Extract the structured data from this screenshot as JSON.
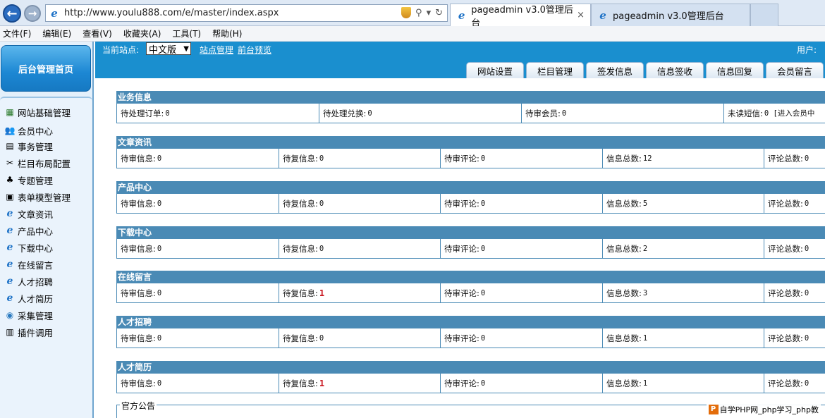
{
  "browser": {
    "address": "http://www.youlu888.com/e/master/index.aspx",
    "tabs": [
      {
        "label": "pageadmin v3.0管理后台",
        "close": "×"
      },
      {
        "label": "pageadmin v3.0管理后台"
      }
    ]
  },
  "menu": [
    "文件(F)",
    "编辑(E)",
    "查看(V)",
    "收藏夹(A)",
    "工具(T)",
    "帮助(H)"
  ],
  "sidebar": {
    "home": "后台管理首页",
    "items": [
      {
        "label": "网站基础管理",
        "icon": "site-basic-icon"
      },
      {
        "label": "会员中心",
        "icon": "members-icon"
      },
      {
        "label": "事务管理",
        "icon": "affairs-icon"
      },
      {
        "label": "栏目布局配置",
        "icon": "tools-icon"
      },
      {
        "label": "专题管理",
        "icon": "topic-icon"
      },
      {
        "label": "表单模型管理",
        "icon": "form-model-icon"
      },
      {
        "label": "文章资讯",
        "icon": "ie-icon"
      },
      {
        "label": "产品中心",
        "icon": "ie-icon"
      },
      {
        "label": "下载中心",
        "icon": "ie-icon"
      },
      {
        "label": "在线留言",
        "icon": "ie-icon"
      },
      {
        "label": "人才招聘",
        "icon": "ie-icon"
      },
      {
        "label": "人才简历",
        "icon": "ie-icon"
      },
      {
        "label": "采集管理",
        "icon": "globe-icon"
      },
      {
        "label": "插件调用",
        "icon": "plugin-icon"
      }
    ]
  },
  "header": {
    "site_label": "当前站点:",
    "site_value": "中文版",
    "link_site": "站点管理",
    "link_preview": "前台预览",
    "user_label": "用户:",
    "tabs": [
      "网站设置",
      "栏目管理",
      "签发信息",
      "信息签收",
      "信息回复",
      "会员留言"
    ]
  },
  "sections": [
    {
      "title": "业务信息",
      "cells": [
        {
          "label": "待处理订单:",
          "value": "0"
        },
        {
          "label": "待处理兑换:",
          "value": "0"
        },
        {
          "label": "待审会员:",
          "value": "0"
        },
        {
          "label": "未读短信:",
          "value": "0 [进入会员中"
        }
      ]
    },
    {
      "title": "文章资讯",
      "cells": [
        {
          "label": "待审信息:",
          "value": "0"
        },
        {
          "label": "待复信息:",
          "value": "0"
        },
        {
          "label": "待审评论:",
          "value": "0"
        },
        {
          "label": "信息总数:",
          "value": "12"
        },
        {
          "label": "评论总数:",
          "value": "0"
        }
      ]
    },
    {
      "title": "产品中心",
      "cells": [
        {
          "label": "待审信息:",
          "value": "0"
        },
        {
          "label": "待复信息:",
          "value": "0"
        },
        {
          "label": "待审评论:",
          "value": "0"
        },
        {
          "label": "信息总数:",
          "value": "5"
        },
        {
          "label": "评论总数:",
          "value": "0"
        }
      ]
    },
    {
      "title": "下载中心",
      "cells": [
        {
          "label": "待审信息:",
          "value": "0"
        },
        {
          "label": "待复信息:",
          "value": "0"
        },
        {
          "label": "待审评论:",
          "value": "0"
        },
        {
          "label": "信息总数:",
          "value": "2"
        },
        {
          "label": "评论总数:",
          "value": "0"
        }
      ]
    },
    {
      "title": "在线留言",
      "cells": [
        {
          "label": "待审信息:",
          "value": "0"
        },
        {
          "label": "待复信息:",
          "value": "1",
          "highlight": true
        },
        {
          "label": "待审评论:",
          "value": "0"
        },
        {
          "label": "信息总数:",
          "value": "3"
        },
        {
          "label": "评论总数:",
          "value": "0"
        }
      ]
    },
    {
      "title": "人才招聘",
      "cells": [
        {
          "label": "待审信息:",
          "value": "0"
        },
        {
          "label": "待复信息:",
          "value": "0"
        },
        {
          "label": "待审评论:",
          "value": "0"
        },
        {
          "label": "信息总数:",
          "value": "1"
        },
        {
          "label": "评论总数:",
          "value": "0"
        }
      ]
    },
    {
      "title": "人才简历",
      "cells": [
        {
          "label": "待审信息:",
          "value": "0"
        },
        {
          "label": "待复信息:",
          "value": "1",
          "highlight": true
        },
        {
          "label": "待审评论:",
          "value": "0"
        },
        {
          "label": "信息总数:",
          "value": "1"
        },
        {
          "label": "评论总数:",
          "value": "0"
        }
      ]
    }
  ],
  "notice": {
    "title": "官方公告"
  },
  "watermark": {
    "text": "自学PHP网_php学习_php教"
  },
  "colors": {
    "header_blue": "#1a8fcf",
    "section_bar": "#4a8ab5",
    "highlight_red": "#c8141d"
  }
}
